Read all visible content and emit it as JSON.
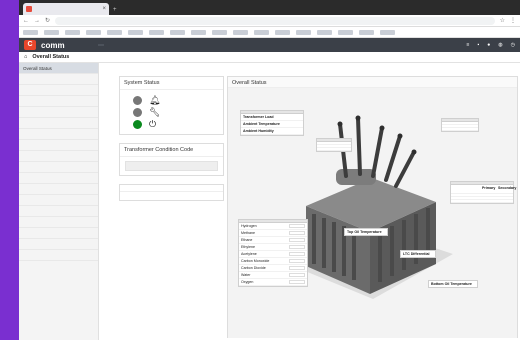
{
  "browser": {
    "tab_title": "",
    "url": ""
  },
  "app": {
    "logo_letter": "C",
    "brand_partial": "comm",
    "brand_accent": "#e8462b",
    "device_selector": ""
  },
  "breadcrumb": {
    "title": "Overall Status"
  },
  "sidebar": {
    "items": [
      {
        "label": "Overall Status",
        "active": true
      },
      {
        "label": "",
        "active": false
      },
      {
        "label": "",
        "active": false
      },
      {
        "label": "",
        "active": false
      },
      {
        "label": "",
        "active": false
      },
      {
        "label": "",
        "active": false
      },
      {
        "label": "",
        "active": false
      },
      {
        "label": "",
        "active": false
      },
      {
        "label": "",
        "active": false
      },
      {
        "label": "",
        "active": false
      },
      {
        "label": "",
        "active": false
      },
      {
        "label": "",
        "active": false
      },
      {
        "label": "",
        "active": false
      },
      {
        "label": "",
        "active": false
      },
      {
        "label": "",
        "active": false
      },
      {
        "label": "",
        "active": false
      },
      {
        "label": "",
        "active": false
      },
      {
        "label": "",
        "active": false
      }
    ]
  },
  "panels": {
    "system_status": {
      "title": "System Status",
      "rows": [
        {
          "color": "#777777",
          "icon": "bell-icon"
        },
        {
          "color": "#777777",
          "icon": "wrench-icon"
        },
        {
          "color": "#0a8a1e",
          "icon": "power-icon"
        }
      ]
    },
    "transformer_condition": {
      "title": "Transformer Condition Code",
      "text": ""
    },
    "messages": {
      "title": "",
      "text": ""
    }
  },
  "overall": {
    "title": "Overall Status",
    "load_box": {
      "title": "",
      "rows": [
        {
          "label": "Transformer Load",
          "value": ""
        },
        {
          "label": "Ambient Temperature",
          "value": ""
        },
        {
          "label": "Ambient Humidity",
          "value": ""
        }
      ]
    },
    "tap_box": {
      "title": "",
      "rows": [
        {
          "label": "",
          "value": ""
        },
        {
          "label": "",
          "value": ""
        },
        {
          "label": "",
          "value": ""
        }
      ]
    },
    "right_box": {
      "title": "",
      "rows": [
        {
          "label": "",
          "value": ""
        },
        {
          "label": "",
          "value": ""
        },
        {
          "label": "",
          "value": ""
        }
      ]
    },
    "gases": {
      "title": "",
      "rows": [
        {
          "label": "Hydrogen",
          "value": ""
        },
        {
          "label": "Methane",
          "value": ""
        },
        {
          "label": "Ethane",
          "value": ""
        },
        {
          "label": "Ethylene",
          "value": ""
        },
        {
          "label": "Acetylene",
          "value": ""
        },
        {
          "label": "Carbon Monoxide",
          "value": ""
        },
        {
          "label": "Carbon Dioxide",
          "value": ""
        },
        {
          "label": "Water",
          "value": ""
        },
        {
          "label": "Oxygen",
          "value": ""
        }
      ]
    },
    "windings": {
      "title": "",
      "col1": "Primary",
      "col2": "Secondary",
      "rows": [
        {
          "label": "",
          "v1": "",
          "v2": ""
        },
        {
          "label": "",
          "v1": "",
          "v2": ""
        },
        {
          "label": "",
          "v1": "",
          "v2": ""
        },
        {
          "label": "",
          "v1": "",
          "v2": ""
        }
      ]
    },
    "top_oil": {
      "label": "Top Oil Temperature",
      "value": ""
    },
    "ltc": {
      "label": "LTC Differential",
      "value": ""
    },
    "bottom_oil": {
      "label": "Bottom Oil Temperature",
      "value": ""
    }
  }
}
